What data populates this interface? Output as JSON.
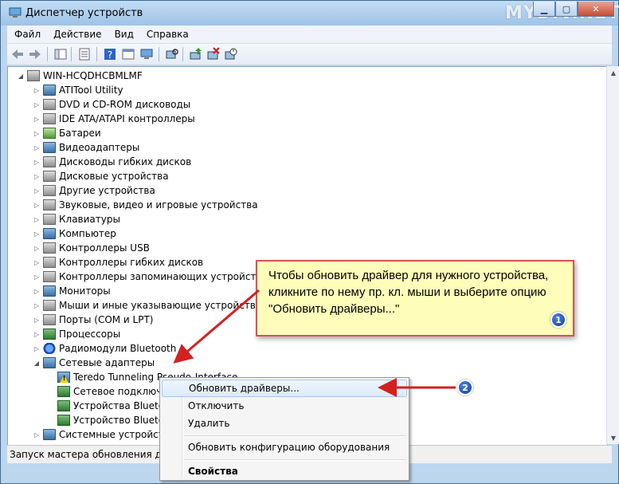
{
  "window": {
    "title": "Диспетчер устройств",
    "watermark": "MYDIV.NET"
  },
  "menubar": {
    "items": [
      "Файл",
      "Действие",
      "Вид",
      "Справка"
    ]
  },
  "toolbar": {
    "icons": [
      "back-arrow-icon",
      "forward-arrow-icon",
      "show-hide-tree-icon",
      "properties-icon",
      "help-icon",
      "console-icon",
      "monitor-icon",
      "update-driver-icon",
      "uninstall-icon",
      "scan-hardware-icon"
    ]
  },
  "tree": {
    "root": "WIN-HCQDHCBMLMF",
    "categories": [
      "ATITool Utility",
      "DVD и CD-ROM дисководы",
      "IDE ATA/ATAPI контроллеры",
      "Батареи",
      "Видеоадаптеры",
      "Дисководы гибких дисков",
      "Дисковые устройства",
      "Другие устройства",
      "Звуковые, видео и игровые устройства",
      "Клавиатуры",
      "Компьютер",
      "Контроллеры USB",
      "Контроллеры гибких дисков",
      "Контроллеры запоминающих устройств",
      "Мониторы",
      "Мыши и иные указывающие устройства",
      "Порты (COM и LPT)",
      "Процессоры",
      "Радиомодули Bluetooth",
      "Сетевые адаптеры"
    ],
    "network_children": [
      "Teredo Tunneling Pseudo-Interface",
      "Сетевое подключение Bluetooth",
      "Устройства Bluetooth",
      "Устройство Bluetooth"
    ],
    "last_category": "Системные устройства"
  },
  "status": {
    "text": "Запуск мастера обновления драйверов для выбранного устройства."
  },
  "context_menu": {
    "items": [
      "Обновить драйверы...",
      "Отключить",
      "Удалить",
      "Обновить конфигурацию оборудования",
      "Свойства"
    ]
  },
  "callout": {
    "text": "Чтобы обновить драйвер для нужного устройства, кликните по нему пр. кл. мыши и выберите опцию \"Обновить драйверы...\"",
    "badge1": "1",
    "badge2": "2"
  },
  "colors": {
    "callout_bg": "#fefdba",
    "callout_border": "#d9534f",
    "arrow": "#d42020",
    "badge": "#1a4fb0"
  }
}
